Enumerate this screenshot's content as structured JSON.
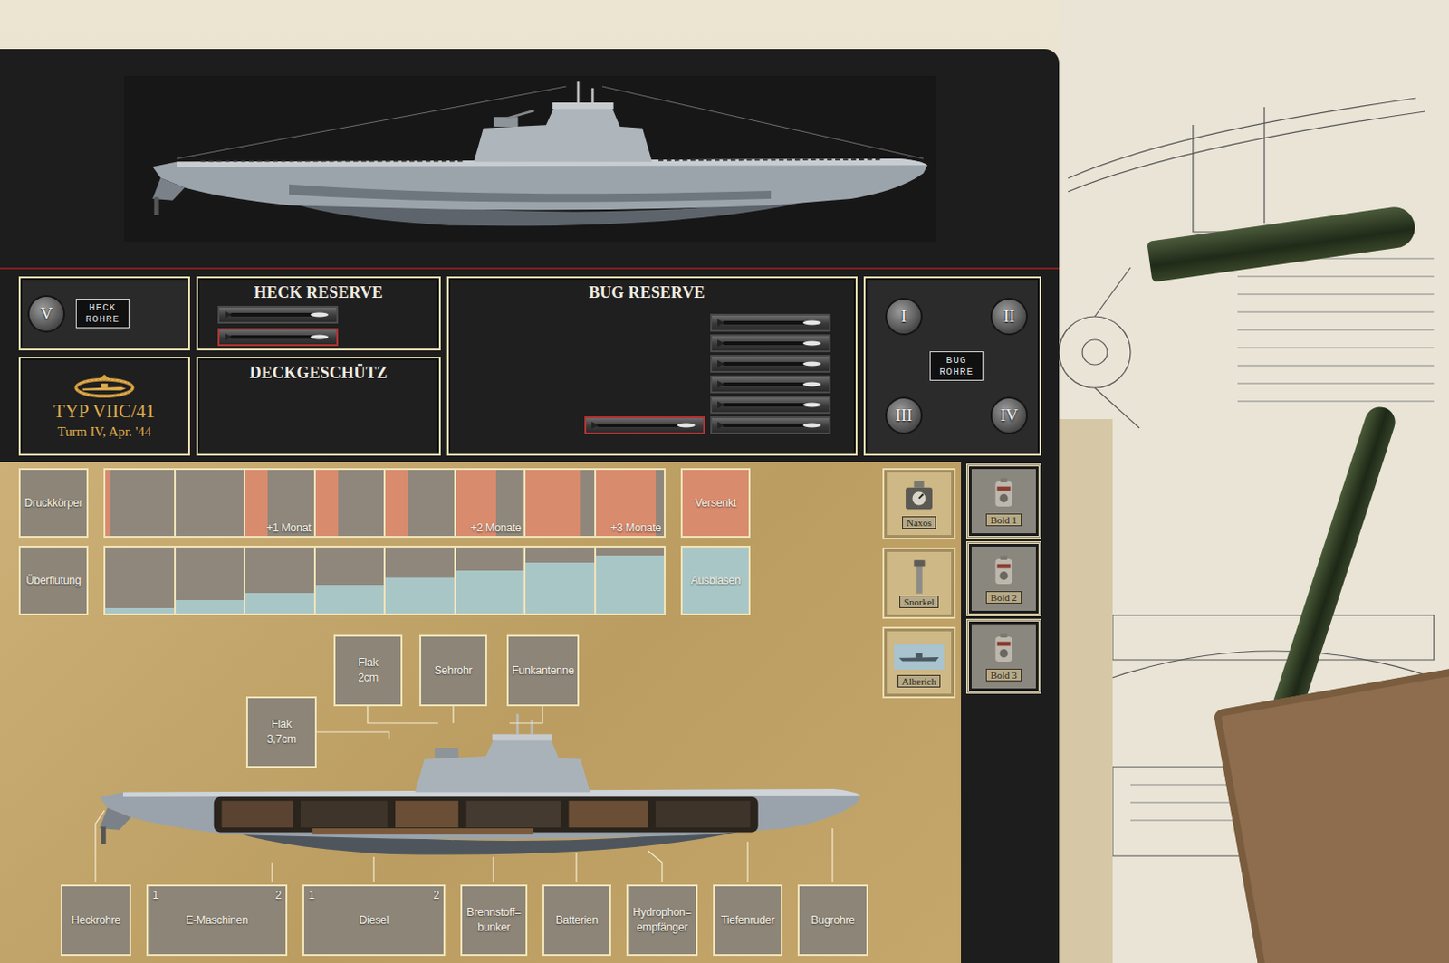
{
  "stern_tubes": {
    "plaque": "HECK\nROHRE",
    "tubes": [
      {
        "label": "V"
      }
    ]
  },
  "stern_reserve": {
    "title": "HECK RESERVE",
    "torpedoes": [
      {
        "selected": false
      },
      {
        "selected": true
      }
    ]
  },
  "bow_reserve": {
    "title": "BUG RESERVE",
    "racks": [
      {
        "selected": false
      },
      {
        "selected": false
      },
      {
        "selected": false
      },
      {
        "selected": false
      },
      {
        "selected": false
      },
      {
        "selected": false
      }
    ],
    "staged": [
      {
        "selected": true
      }
    ]
  },
  "bow_tubes": {
    "plaque": "BUG\nROHRE",
    "tubes": [
      {
        "label": "I"
      },
      {
        "label": "II"
      },
      {
        "label": "III"
      },
      {
        "label": "IV"
      }
    ]
  },
  "type_card": {
    "type": "TYP VIIC/41",
    "refit": "Turm IV, Apr. '44"
  },
  "deck_gun": {
    "title": "DECKGESCHÜTZ"
  },
  "damage_tracks": [
    {
      "label": "Druckkörper",
      "kind": "hull",
      "color": "#d98b6e",
      "end": "Versenkt",
      "cells": [
        {
          "level": 0.08
        },
        {
          "level": 0
        },
        {
          "level": 0.33,
          "note": "+1 Monat"
        },
        {
          "level": 0.33
        },
        {
          "level": 0.33
        },
        {
          "level": 0.6,
          "note": "+2 Monate"
        },
        {
          "level": 0.8
        },
        {
          "level": 0.88,
          "note": "+3 Monate"
        }
      ]
    },
    {
      "label": "Überflutung",
      "kind": "flooding",
      "color": "#a9c6c7",
      "end": "Ausblasen",
      "cells": [
        {
          "level": 0.08
        },
        {
          "level": 0.2
        },
        {
          "level": 0.31
        },
        {
          "level": 0.43
        },
        {
          "level": 0.54
        },
        {
          "level": 0.65
        },
        {
          "level": 0.77
        },
        {
          "level": 0.88
        }
      ]
    }
  ],
  "systems": {
    "top": [
      {
        "label": "Flak\n2cm"
      },
      {
        "label": "Sehrohr"
      },
      {
        "label": "Funkantenne"
      },
      {
        "label": "Flak\n3,7cm"
      }
    ],
    "bottom": [
      {
        "label": "Heckrohre",
        "slots": []
      },
      {
        "label": "E-Maschinen",
        "slots": [
          "1",
          "2"
        ]
      },
      {
        "label": "Diesel",
        "slots": [
          "1",
          "2"
        ]
      },
      {
        "label": "Brennstoff=\nbunker",
        "slots": []
      },
      {
        "label": "Batterien",
        "slots": []
      },
      {
        "label": "Hydrophon=\nempfänger",
        "slots": []
      },
      {
        "label": "Tiefenruder",
        "slots": []
      },
      {
        "label": "Bugrohre",
        "slots": []
      }
    ]
  },
  "equipment": [
    {
      "label": "Naxos",
      "kind": "naxos"
    },
    {
      "label": "Snorkel",
      "kind": "snorkel"
    },
    {
      "label": "Alberich",
      "kind": "alberich"
    }
  ],
  "crew": [
    {
      "label": "Bold 1"
    },
    {
      "label": "Bold 2"
    },
    {
      "label": "Bold 3"
    }
  ]
}
